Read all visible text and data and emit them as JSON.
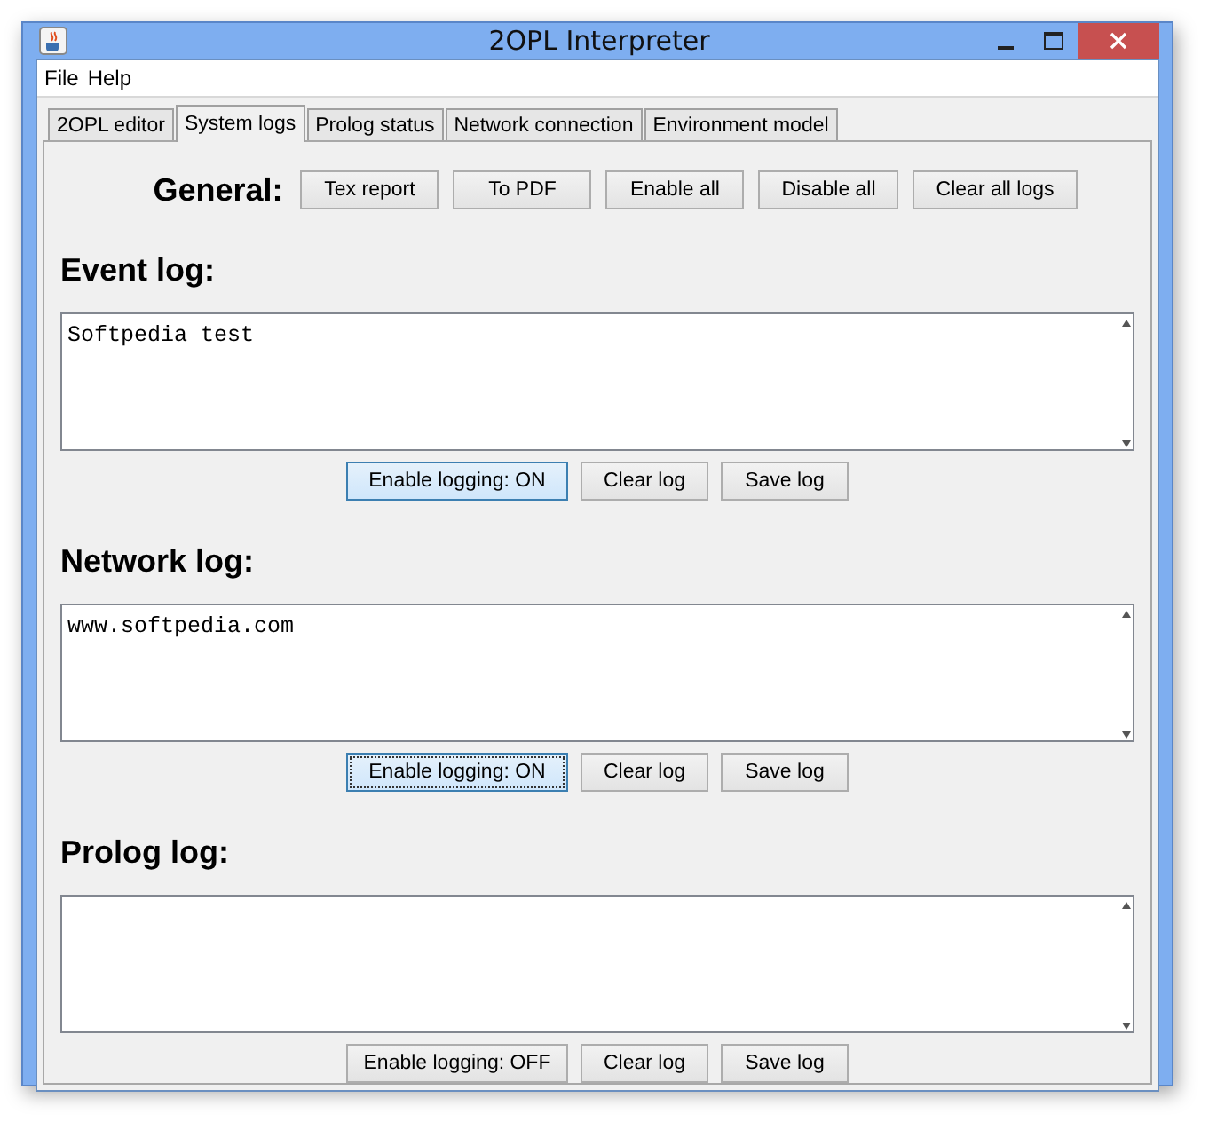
{
  "window": {
    "title": "2OPL Interpreter"
  },
  "menu": [
    "File",
    "Help"
  ],
  "tabs": [
    {
      "label": "2OPL editor",
      "selected": false
    },
    {
      "label": "System logs",
      "selected": true
    },
    {
      "label": "Prolog status",
      "selected": false
    },
    {
      "label": "Network connection",
      "selected": false
    },
    {
      "label": "Environment model",
      "selected": false
    }
  ],
  "general": {
    "label": "General:",
    "buttons": [
      "Tex report",
      "To PDF",
      "Enable all",
      "Disable all",
      "Clear all logs"
    ]
  },
  "logs": [
    {
      "title": "Event log:",
      "text": "Softpedia test",
      "toggle": {
        "label": "Enable logging:  ON",
        "on": true,
        "focused": false
      },
      "buttons": [
        "Clear log",
        "Save log"
      ]
    },
    {
      "title": "Network log:",
      "text": "www.softpedia.com",
      "toggle": {
        "label": "Enable logging:  ON",
        "on": true,
        "focused": true
      },
      "buttons": [
        "Clear log",
        "Save log"
      ]
    },
    {
      "title": "Prolog log:",
      "toggle": {
        "label": "Enable logging: OFF",
        "on": false,
        "focused": false
      },
      "buttons": [
        "Clear log",
        "Save log"
      ]
    }
  ]
}
